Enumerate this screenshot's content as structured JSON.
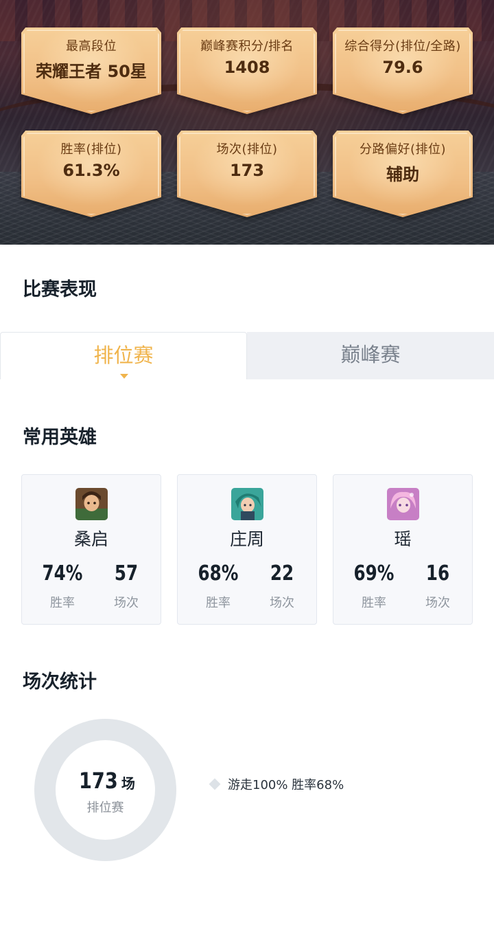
{
  "summary": {
    "cards": [
      {
        "label": "最高段位",
        "value": "荣耀王者 50星"
      },
      {
        "label": "巅峰赛积分/排名",
        "value": "1408"
      },
      {
        "label": "综合得分(排位/全路)",
        "value": "79.6"
      },
      {
        "label": "胜率(排位)",
        "value": "61.3%"
      },
      {
        "label": "场次(排位)",
        "value": "173"
      },
      {
        "label": "分路偏好(排位)",
        "value": "辅助"
      }
    ]
  },
  "performance": {
    "title": "比赛表现",
    "tabs": [
      {
        "label": "排位赛",
        "active": true
      },
      {
        "label": "巅峰赛",
        "active": false
      }
    ]
  },
  "heroes": {
    "title": "常用英雄",
    "items": [
      {
        "name": "桑启",
        "winrate": "74%",
        "winrate_label": "胜率",
        "games": "57",
        "games_label": "场次"
      },
      {
        "name": "庄周",
        "winrate": "68%",
        "winrate_label": "胜率",
        "games": "22",
        "games_label": "场次"
      },
      {
        "name": "瑶",
        "winrate": "69%",
        "winrate_label": "胜率",
        "games": "16",
        "games_label": "场次"
      }
    ]
  },
  "match_stats": {
    "title": "场次统计",
    "total": "173",
    "unit": "场",
    "sub_label": "排位赛",
    "legend": [
      {
        "text": "游走100% 胜率68%",
        "share": 1.0
      }
    ],
    "colors": {
      "ring": "#e2e6ea",
      "accent": "#f0b44c"
    }
  }
}
